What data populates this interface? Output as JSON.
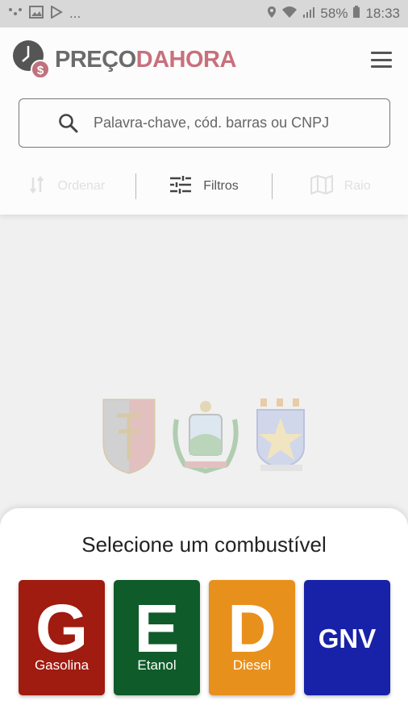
{
  "status_bar": {
    "battery": "58%",
    "time": "18:33",
    "more": "..."
  },
  "header": {
    "logo_part1": "PREÇO",
    "logo_part2": "DAHORA",
    "logo_symbol": "$"
  },
  "search": {
    "placeholder": "Palavra-chave, cód. barras ou CNPJ"
  },
  "toolbar": {
    "left_label": "Ordenar",
    "filters_label": "Filtros",
    "right_label": "Raio"
  },
  "sheet": {
    "title": "Selecione um combustível",
    "fuels": [
      {
        "letter": "G",
        "name": "Gasolina",
        "color": "#a01b10"
      },
      {
        "letter": "E",
        "name": "Etanol",
        "color": "#0f5b2a"
      },
      {
        "letter": "D",
        "name": "Diesel",
        "color": "#e8901c"
      },
      {
        "letter": "GNV",
        "name": "",
        "color": "#1822a8"
      }
    ]
  },
  "colors": {
    "brand_red": "#c8707c",
    "brand_gray": "#6b6b6b"
  }
}
